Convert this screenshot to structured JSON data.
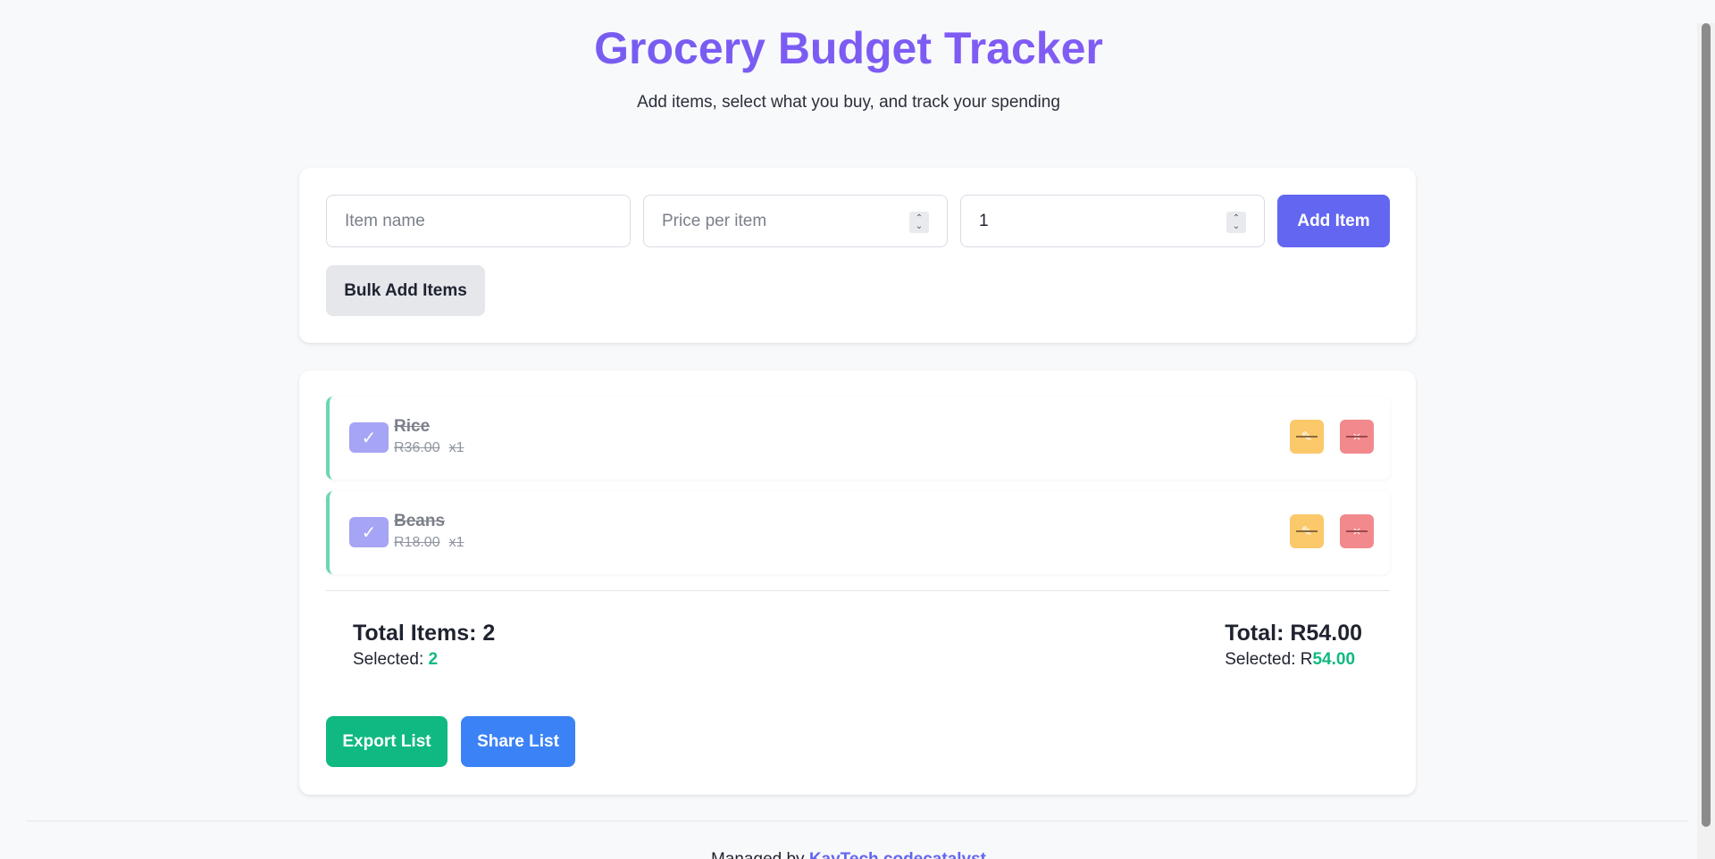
{
  "header": {
    "title": "Grocery Budget Tracker",
    "subtitle": "Add items, select what you buy, and track your spending"
  },
  "form": {
    "item_name_placeholder": "Item name",
    "price_placeholder": "Price per item",
    "quantity_value": "1",
    "add_label": "Add Item",
    "bulk_label": "Bulk Add Items"
  },
  "items": [
    {
      "name": "Rice",
      "price": "R36.00",
      "qty": "x1",
      "selected": true
    },
    {
      "name": "Beans",
      "price": "R18.00",
      "qty": "x1",
      "selected": true
    }
  ],
  "icons": {
    "check": "✓",
    "edit": "✎",
    "delete": "×"
  },
  "summary": {
    "total_items_label": "Total Items: 2",
    "selected_label": "Selected: ",
    "selected_count": "2",
    "total_label": "Total: R54.00",
    "selected_amount_prefix": "Selected: R",
    "selected_amount": "54.00"
  },
  "actions": {
    "export_label": "Export List",
    "share_label": "Share List"
  },
  "footer": {
    "prefix": "Managed by ",
    "link": "KayTech codecatalyst"
  },
  "colors": {
    "accent": "#6366f1",
    "green": "#10b981",
    "blue": "#3b82f6",
    "edit": "#fbc86a",
    "delete": "#f2898c"
  }
}
